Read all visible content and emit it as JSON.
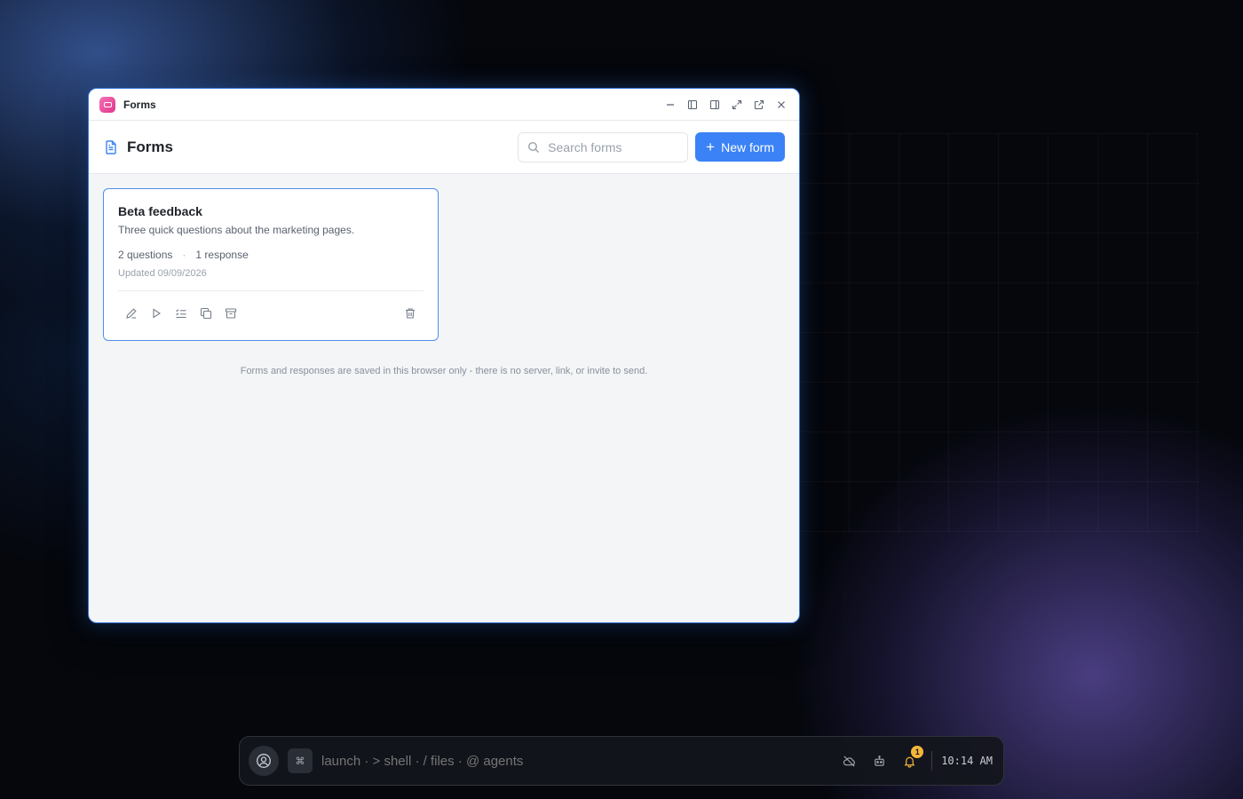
{
  "window": {
    "title": "Forms",
    "accent_color": "#3b82f6",
    "app_icon_color": "#e0368a"
  },
  "header": {
    "title": "Forms",
    "search_placeholder": "Search forms",
    "search_value": "",
    "new_button_label": "New form"
  },
  "forms": [
    {
      "title": "Beta feedback",
      "description": "Three quick questions about the marketing pages.",
      "questions": "2 questions",
      "separator": "·",
      "responses": "1 response",
      "updated": "Updated 09/09/2026"
    }
  ],
  "footnote": "Forms and responses are saved in this browser only - there is no server, link, or invite to send.",
  "taskbar": {
    "command_key": "⌘",
    "launch_hint": "launch · > shell · / files · @ agents",
    "notification_count": "1",
    "clock": "10:14 AM"
  }
}
